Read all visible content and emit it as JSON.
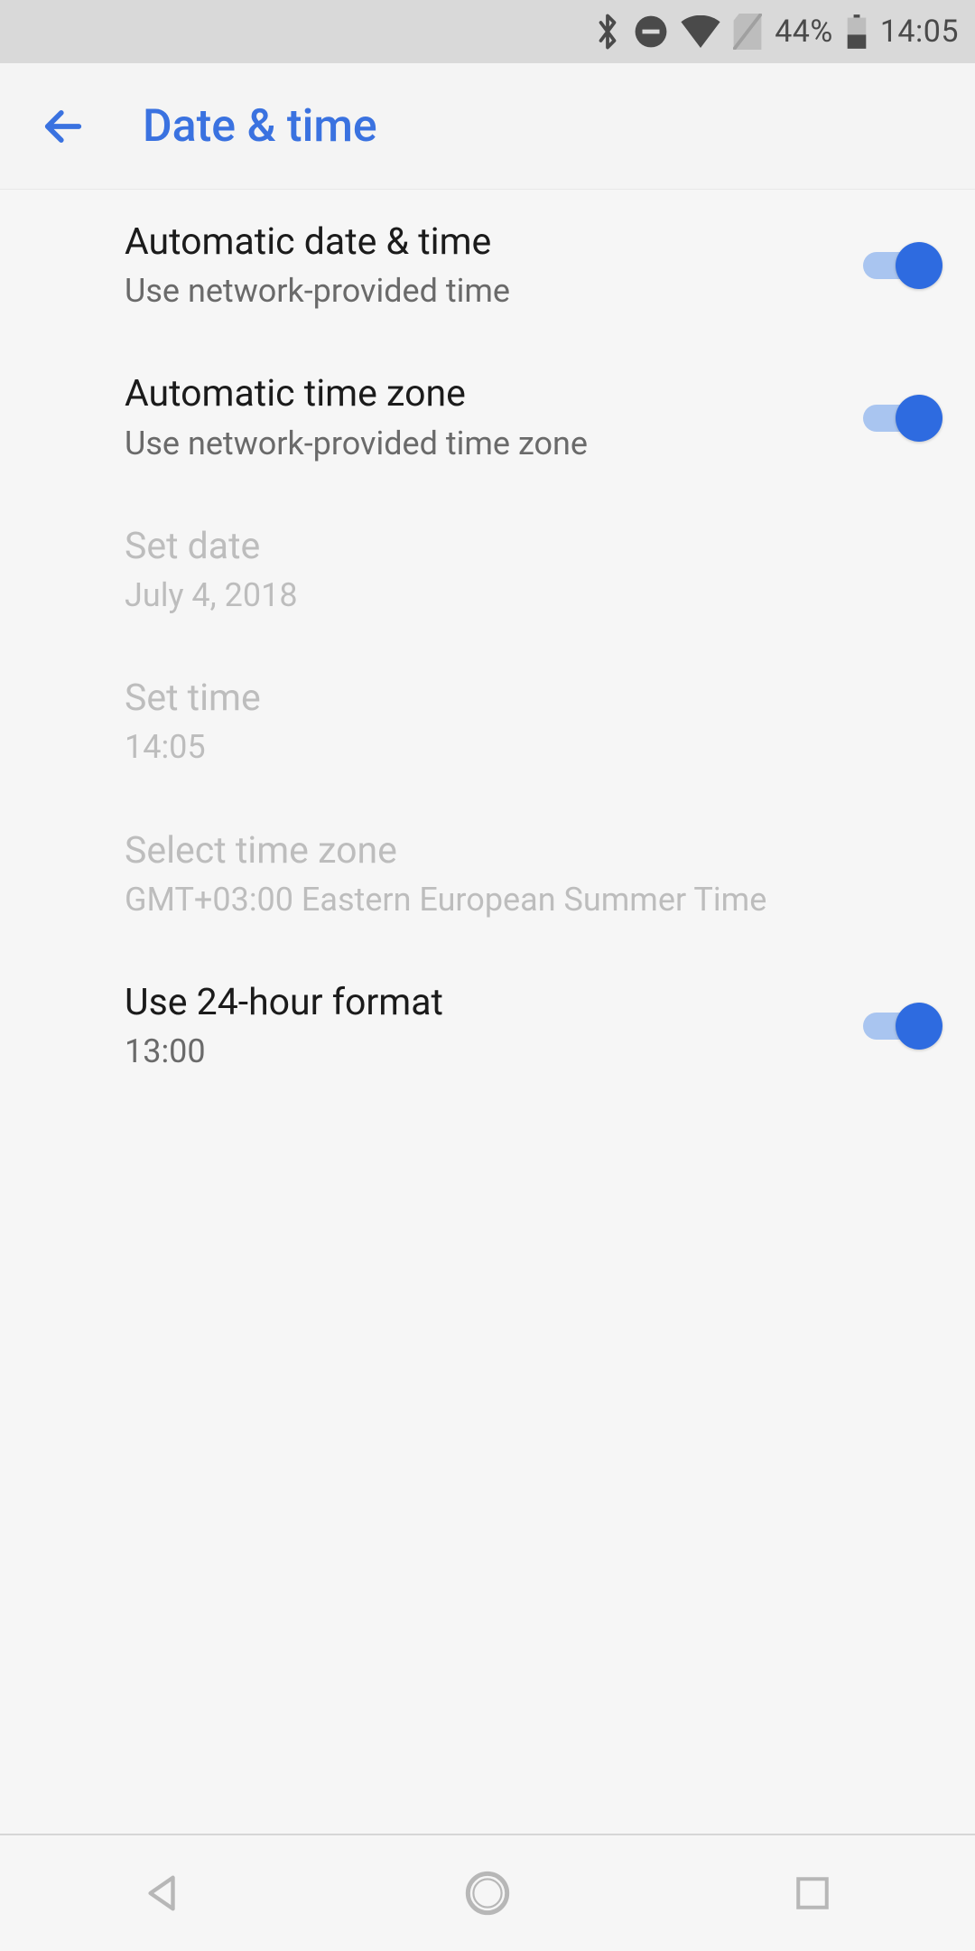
{
  "status_bar": {
    "battery_percent": "44%",
    "clock": "14:05"
  },
  "header": {
    "title": "Date & time"
  },
  "settings": [
    {
      "key": "auto_datetime",
      "title": "Automatic date & time",
      "subtitle": "Use network-provided time",
      "toggle_on": true,
      "disabled": false
    },
    {
      "key": "auto_timezone",
      "title": "Automatic time zone",
      "subtitle": "Use network-provided time zone",
      "toggle_on": true,
      "disabled": false
    },
    {
      "key": "set_date",
      "title": "Set date",
      "subtitle": "July 4, 2018",
      "toggle_on": null,
      "disabled": true
    },
    {
      "key": "set_time",
      "title": "Set time",
      "subtitle": "14:05",
      "toggle_on": null,
      "disabled": true
    },
    {
      "key": "select_timezone",
      "title": "Select time zone",
      "subtitle": "GMT+03:00 Eastern European Summer Time",
      "toggle_on": null,
      "disabled": true
    },
    {
      "key": "use_24h",
      "title": "Use 24-hour format",
      "subtitle": "13:00",
      "toggle_on": true,
      "disabled": false
    }
  ],
  "colors": {
    "accent": "#2e6be0",
    "track": "#a9c5f0"
  }
}
